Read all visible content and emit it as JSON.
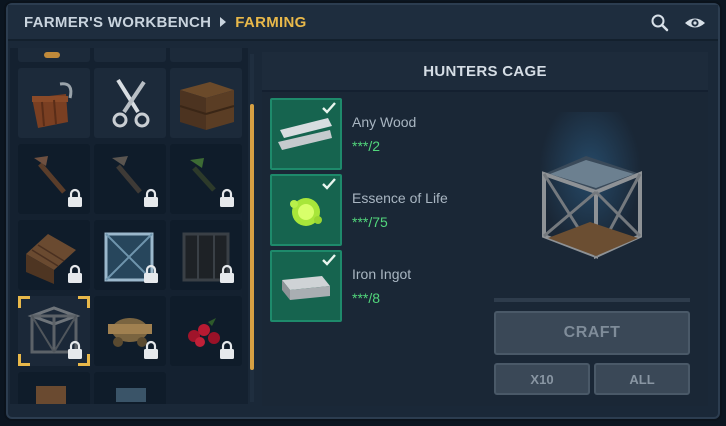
{
  "header": {
    "breadcrumb_root": "FARMER'S WORKBENCH",
    "breadcrumb_active": "FARMING",
    "icons": [
      "search-icon",
      "eye-icon"
    ]
  },
  "grid": {
    "items": [
      {
        "name": "partial-top-1",
        "locked": false
      },
      {
        "name": "partial-top-2",
        "locked": false
      },
      {
        "name": "partial-top-3",
        "locked": false
      },
      {
        "name": "wooden-bucket",
        "locked": false
      },
      {
        "name": "shears",
        "locked": false
      },
      {
        "name": "wooden-crate",
        "locked": false
      },
      {
        "name": "wooden-hoe",
        "locked": true
      },
      {
        "name": "stone-hoe",
        "locked": true
      },
      {
        "name": "green-hoe",
        "locked": true
      },
      {
        "name": "wooden-kennel",
        "locked": true
      },
      {
        "name": "blue-cage",
        "locked": true
      },
      {
        "name": "dark-cage",
        "locked": true
      },
      {
        "name": "hunters-cage",
        "locked": true,
        "selected": true
      },
      {
        "name": "brass-contraption",
        "locked": true
      },
      {
        "name": "red-berries",
        "locked": true
      },
      {
        "name": "partial-bottom-1",
        "locked": false
      },
      {
        "name": "partial-bottom-2",
        "locked": false
      }
    ],
    "scroll_position": 0.18
  },
  "detail": {
    "title": "HUNTERS CAGE",
    "ingredients": [
      {
        "name": "Any Wood",
        "count": "***/2",
        "icon": "planks-icon"
      },
      {
        "name": "Essence of Life",
        "count": "***/75",
        "icon": "essence-icon"
      },
      {
        "name": "Iron Ingot",
        "count": "***/8",
        "icon": "ingot-icon"
      }
    ],
    "craft_label": "CRAFT",
    "x10_label": "X10",
    "all_label": "ALL",
    "progress": 0
  },
  "colors": {
    "accent": "#e8b84a",
    "ingredient_bg": "#16644f",
    "count_green": "#52d67c"
  }
}
